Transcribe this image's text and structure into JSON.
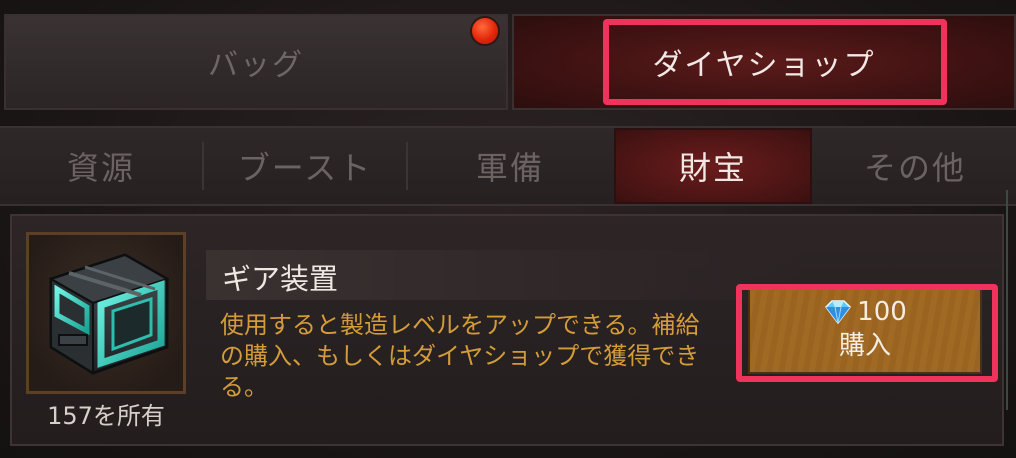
{
  "top_tabs": [
    {
      "label": "バッグ",
      "active": false,
      "has_notification": true
    },
    {
      "label": "ダイヤショップ",
      "active": true
    }
  ],
  "sub_tabs": [
    {
      "label": "資源",
      "active": false
    },
    {
      "label": "ブースト",
      "active": false
    },
    {
      "label": "軍備",
      "active": false
    },
    {
      "label": "財宝",
      "active": true
    },
    {
      "label": "その他",
      "active": false
    }
  ],
  "item": {
    "icon": "gear-device-crate-icon",
    "owned_label": "157を所有",
    "title": "ギア装置",
    "description": "使用すると製造レベルをアップできる。補給の購入、もしくはダイヤショップで獲得できる。",
    "price": "100",
    "price_icon": "diamond-icon",
    "buy_label": "購入"
  },
  "colors": {
    "highlight": "#f0325c",
    "active_tab": "#5c1a1a",
    "description_text": "#d49c38",
    "buy_button": "#a06a24"
  }
}
